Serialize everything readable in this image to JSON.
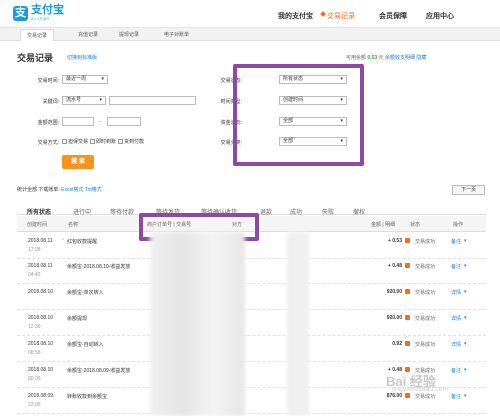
{
  "header": {
    "logo_glyph": "支",
    "brand": "支付宝",
    "brand_sub": "ALIPAY",
    "nav": [
      "我的支付宝",
      "交易记录",
      "会员保障",
      "应用中心"
    ]
  },
  "subtabs": [
    "交易记录",
    "充值记录",
    "提现记录",
    "电子对账单"
  ],
  "page": {
    "title": "交易记录",
    "switch_link": "切换到标准版",
    "balance_label": "可用余额",
    "balance_value": "0.53",
    "balance_unit": "元",
    "balance_links": [
      "余额收支明细",
      "隐藏"
    ]
  },
  "filters": {
    "time_label": "交易时间:",
    "time_value": "最近一周",
    "keyword_label": "关键词:",
    "keyword_value": "流水号",
    "amount_label": "金额范围:",
    "amount_sep": "-",
    "mode_label": "交易方式:",
    "mode_options": [
      "担保交易",
      "即时到账",
      "货到付款"
    ],
    "search_button": "搜 索",
    "status_label": "交易状态:",
    "status_value": "所有状态",
    "timetype_label": "时间类型:",
    "timetype_value": "创建时间",
    "flow_label": "资金流向:",
    "flow_value": "全部",
    "category_label": "交易分类:",
    "category_value": "全部"
  },
  "export": {
    "prefix": "统计全部 下载账单:",
    "excel": "Excel格式",
    "txt": "Txt格式"
  },
  "next_button": "下一页",
  "filter_tabs": [
    "所有状态",
    "进行中",
    "等待付款",
    "等待发货",
    "等待确认收货",
    "退款",
    "成功",
    "失败",
    "撤权"
  ],
  "table": {
    "headers": [
      "创建时间",
      "名称",
      "商户订单号 | 交易号",
      "对方",
      "金额 | 明细",
      "状态",
      "操作"
    ],
    "rows": [
      {
        "date": "2018.08.11",
        "time": "17:28",
        "name": "红包收款提醒",
        "amount": "+ 0.53",
        "status": "交易成功",
        "op": "备注"
      },
      {
        "date": "2018.08.11",
        "time": "04:42",
        "name": "余额宝-2018.08.10-收益发放",
        "amount": "+ 0.48",
        "status": "交易成功",
        "op": "备注"
      },
      {
        "date": "2018.08.10",
        "time": "",
        "name": "余额宝-单次转入",
        "amount": "920.00",
        "status": "交易成功",
        "op": "详情"
      },
      {
        "date": "2018.08.10",
        "time": "12:39",
        "name": "余额提现",
        "amount": "920.00",
        "status": "交易成功",
        "op": "详情"
      },
      {
        "date": "2018.08.10",
        "time": "08:58",
        "name": "余额宝-自动转入",
        "amount": "0.92",
        "status": "交易成功",
        "op": "详情"
      },
      {
        "date": "2018.08.10",
        "time": "05:06",
        "name": "余额宝-2018.08.09-收益发放",
        "amount": "+ 0.48",
        "status": "交易成功",
        "op": "备注"
      },
      {
        "date": "2018.08.09",
        "time": "22:05",
        "name": "转账收款到余额宝",
        "amount": "876.00",
        "status": "交易成功",
        "op": "备注"
      }
    ]
  },
  "watermark": {
    "main": "Bai 经验",
    "sub": "jingyan.baidu.com"
  },
  "colors": {
    "accent": "#1a9bdb",
    "orange": "#f7941d",
    "highlight": "#8e4aa3"
  }
}
